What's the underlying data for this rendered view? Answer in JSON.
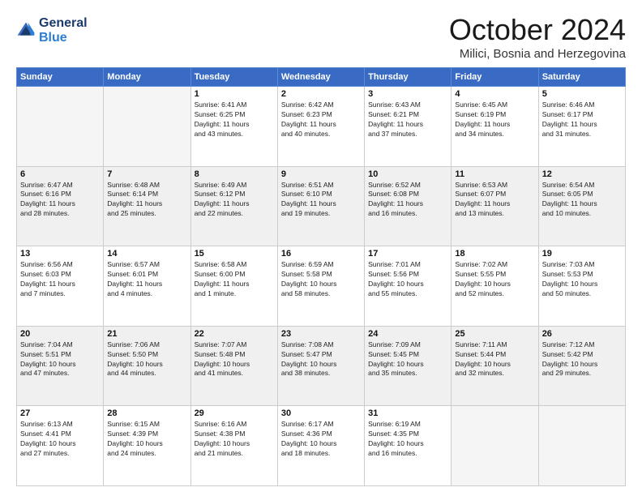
{
  "header": {
    "logo_line1": "General",
    "logo_line2": "Blue",
    "month_title": "October 2024",
    "location": "Milici, Bosnia and Herzegovina"
  },
  "weekdays": [
    "Sunday",
    "Monday",
    "Tuesday",
    "Wednesday",
    "Thursday",
    "Friday",
    "Saturday"
  ],
  "weeks": [
    [
      {
        "day": "",
        "detail": ""
      },
      {
        "day": "",
        "detail": ""
      },
      {
        "day": "1",
        "detail": "Sunrise: 6:41 AM\nSunset: 6:25 PM\nDaylight: 11 hours\nand 43 minutes."
      },
      {
        "day": "2",
        "detail": "Sunrise: 6:42 AM\nSunset: 6:23 PM\nDaylight: 11 hours\nand 40 minutes."
      },
      {
        "day": "3",
        "detail": "Sunrise: 6:43 AM\nSunset: 6:21 PM\nDaylight: 11 hours\nand 37 minutes."
      },
      {
        "day": "4",
        "detail": "Sunrise: 6:45 AM\nSunset: 6:19 PM\nDaylight: 11 hours\nand 34 minutes."
      },
      {
        "day": "5",
        "detail": "Sunrise: 6:46 AM\nSunset: 6:17 PM\nDaylight: 11 hours\nand 31 minutes."
      }
    ],
    [
      {
        "day": "6",
        "detail": "Sunrise: 6:47 AM\nSunset: 6:16 PM\nDaylight: 11 hours\nand 28 minutes."
      },
      {
        "day": "7",
        "detail": "Sunrise: 6:48 AM\nSunset: 6:14 PM\nDaylight: 11 hours\nand 25 minutes."
      },
      {
        "day": "8",
        "detail": "Sunrise: 6:49 AM\nSunset: 6:12 PM\nDaylight: 11 hours\nand 22 minutes."
      },
      {
        "day": "9",
        "detail": "Sunrise: 6:51 AM\nSunset: 6:10 PM\nDaylight: 11 hours\nand 19 minutes."
      },
      {
        "day": "10",
        "detail": "Sunrise: 6:52 AM\nSunset: 6:08 PM\nDaylight: 11 hours\nand 16 minutes."
      },
      {
        "day": "11",
        "detail": "Sunrise: 6:53 AM\nSunset: 6:07 PM\nDaylight: 11 hours\nand 13 minutes."
      },
      {
        "day": "12",
        "detail": "Sunrise: 6:54 AM\nSunset: 6:05 PM\nDaylight: 11 hours\nand 10 minutes."
      }
    ],
    [
      {
        "day": "13",
        "detail": "Sunrise: 6:56 AM\nSunset: 6:03 PM\nDaylight: 11 hours\nand 7 minutes."
      },
      {
        "day": "14",
        "detail": "Sunrise: 6:57 AM\nSunset: 6:01 PM\nDaylight: 11 hours\nand 4 minutes."
      },
      {
        "day": "15",
        "detail": "Sunrise: 6:58 AM\nSunset: 6:00 PM\nDaylight: 11 hours\nand 1 minute."
      },
      {
        "day": "16",
        "detail": "Sunrise: 6:59 AM\nSunset: 5:58 PM\nDaylight: 10 hours\nand 58 minutes."
      },
      {
        "day": "17",
        "detail": "Sunrise: 7:01 AM\nSunset: 5:56 PM\nDaylight: 10 hours\nand 55 minutes."
      },
      {
        "day": "18",
        "detail": "Sunrise: 7:02 AM\nSunset: 5:55 PM\nDaylight: 10 hours\nand 52 minutes."
      },
      {
        "day": "19",
        "detail": "Sunrise: 7:03 AM\nSunset: 5:53 PM\nDaylight: 10 hours\nand 50 minutes."
      }
    ],
    [
      {
        "day": "20",
        "detail": "Sunrise: 7:04 AM\nSunset: 5:51 PM\nDaylight: 10 hours\nand 47 minutes."
      },
      {
        "day": "21",
        "detail": "Sunrise: 7:06 AM\nSunset: 5:50 PM\nDaylight: 10 hours\nand 44 minutes."
      },
      {
        "day": "22",
        "detail": "Sunrise: 7:07 AM\nSunset: 5:48 PM\nDaylight: 10 hours\nand 41 minutes."
      },
      {
        "day": "23",
        "detail": "Sunrise: 7:08 AM\nSunset: 5:47 PM\nDaylight: 10 hours\nand 38 minutes."
      },
      {
        "day": "24",
        "detail": "Sunrise: 7:09 AM\nSunset: 5:45 PM\nDaylight: 10 hours\nand 35 minutes."
      },
      {
        "day": "25",
        "detail": "Sunrise: 7:11 AM\nSunset: 5:44 PM\nDaylight: 10 hours\nand 32 minutes."
      },
      {
        "day": "26",
        "detail": "Sunrise: 7:12 AM\nSunset: 5:42 PM\nDaylight: 10 hours\nand 29 minutes."
      }
    ],
    [
      {
        "day": "27",
        "detail": "Sunrise: 6:13 AM\nSunset: 4:41 PM\nDaylight: 10 hours\nand 27 minutes."
      },
      {
        "day": "28",
        "detail": "Sunrise: 6:15 AM\nSunset: 4:39 PM\nDaylight: 10 hours\nand 24 minutes."
      },
      {
        "day": "29",
        "detail": "Sunrise: 6:16 AM\nSunset: 4:38 PM\nDaylight: 10 hours\nand 21 minutes."
      },
      {
        "day": "30",
        "detail": "Sunrise: 6:17 AM\nSunset: 4:36 PM\nDaylight: 10 hours\nand 18 minutes."
      },
      {
        "day": "31",
        "detail": "Sunrise: 6:19 AM\nSunset: 4:35 PM\nDaylight: 10 hours\nand 16 minutes."
      },
      {
        "day": "",
        "detail": ""
      },
      {
        "day": "",
        "detail": ""
      }
    ]
  ]
}
